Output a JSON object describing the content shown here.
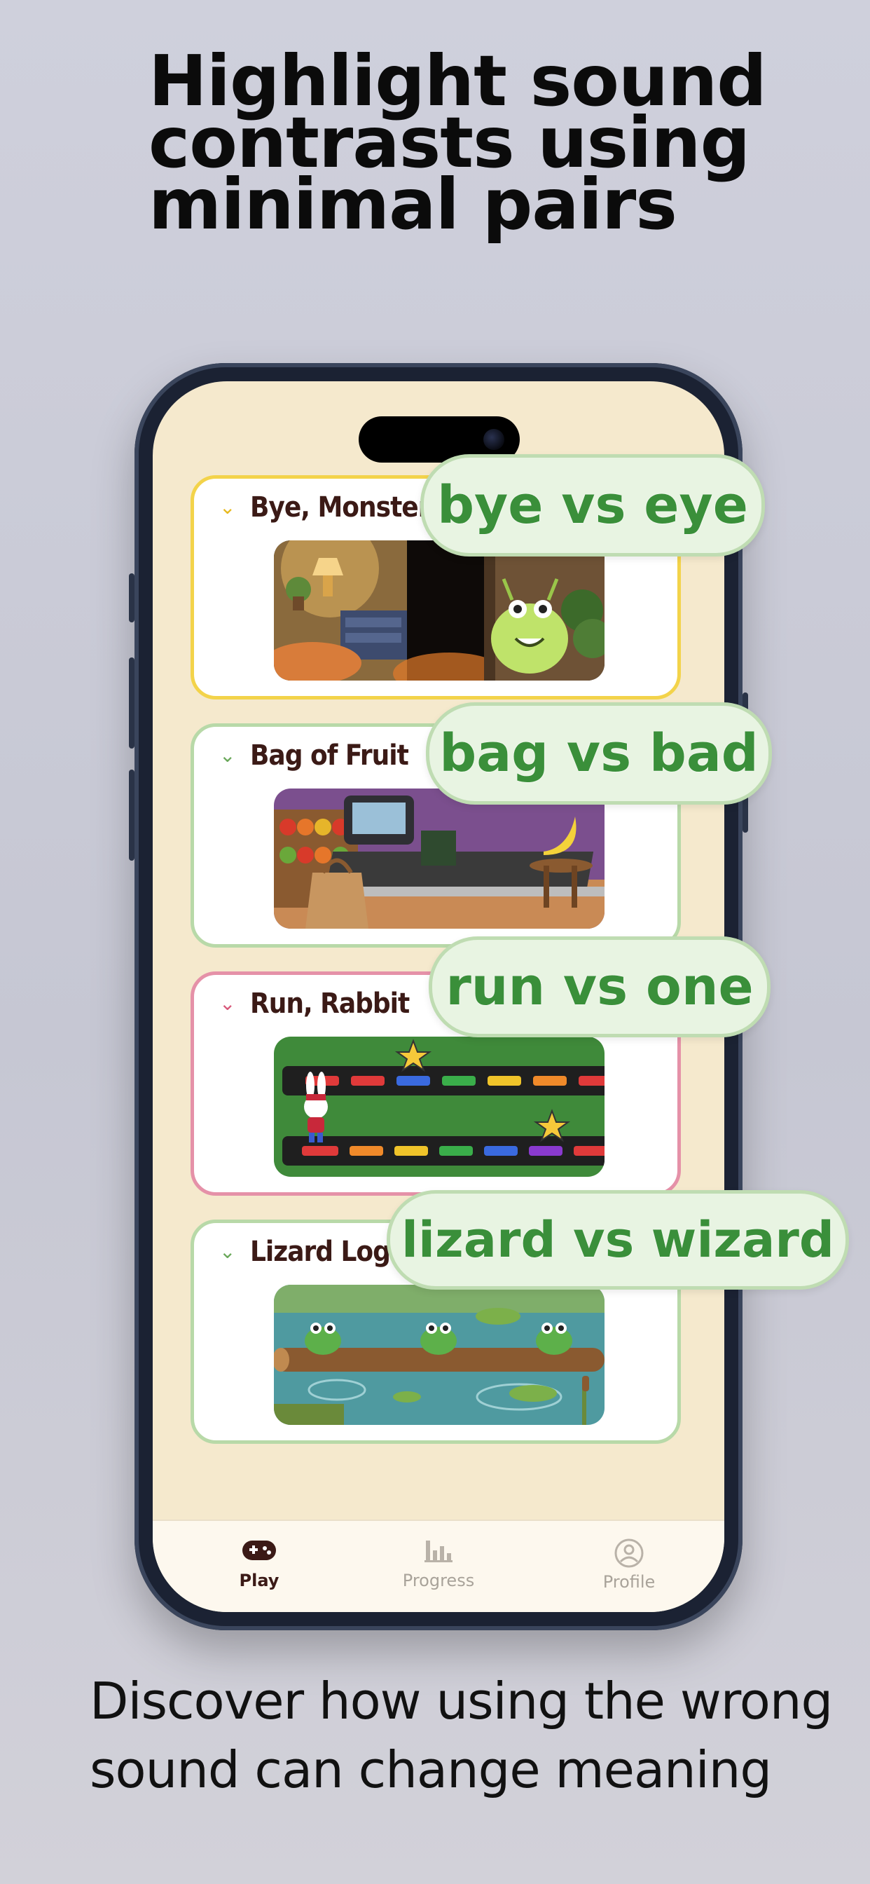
{
  "headline": [
    "Highlight sound",
    "contrasts using",
    "minimal pairs"
  ],
  "subtitle": [
    "Discover how using the wrong",
    "sound can change meaning"
  ],
  "games": [
    {
      "title": "Bye, Monster",
      "accent": "#f3d34a",
      "pair": "bye vs eye"
    },
    {
      "title": "Bag of Fruit",
      "accent": "#b8d9a8",
      "pair": "bag vs bad"
    },
    {
      "title": "Run, Rabbit",
      "accent": "#e591a8",
      "pair": "run vs one"
    },
    {
      "title": "Lizard Log",
      "accent": "#b8d9a8",
      "pair": "lizard vs wizard"
    }
  ],
  "tabs": [
    {
      "label": "Play",
      "icon": "gamepad-icon",
      "active": true
    },
    {
      "label": "Progress",
      "icon": "bar-chart-icon",
      "active": false
    },
    {
      "label": "Profile",
      "icon": "user-circle-icon",
      "active": false
    }
  ],
  "colors": {
    "pill_text": "#3a8f3a",
    "pill_bg": "#e8f4e2",
    "screen_bg": "#f5e9cd",
    "active_tab": "#3b1a16",
    "inactive_tab": "#a9a39a"
  }
}
